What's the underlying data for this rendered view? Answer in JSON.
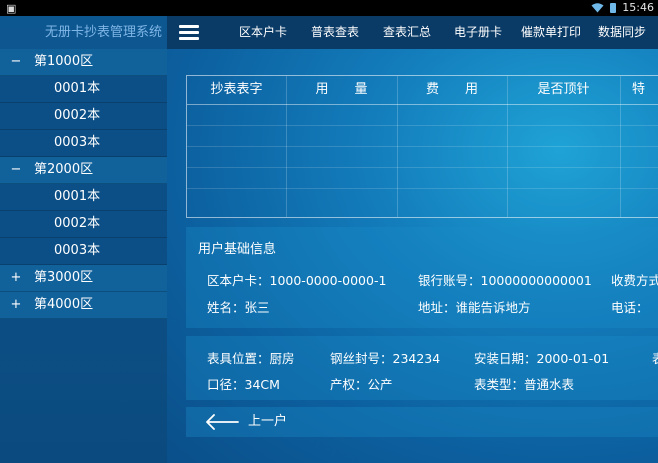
{
  "status": {
    "time": "15:46"
  },
  "sidebar": {
    "title": "无册卡抄表管理系统",
    "groups": [
      {
        "sign": "−",
        "label": "第1000区",
        "children": [
          "0001本",
          "0002本",
          "0003本"
        ]
      },
      {
        "sign": "−",
        "label": "第2000区",
        "children": [
          "0001本",
          "0002本",
          "0003本"
        ]
      },
      {
        "sign": "+",
        "label": "第3000区"
      },
      {
        "sign": "+",
        "label": "第4000区"
      }
    ]
  },
  "nav": {
    "items": [
      "区本户卡",
      "普表查表",
      "查表汇总",
      "电子册卡",
      "催款单打印",
      "数据同步"
    ]
  },
  "table": {
    "headers": [
      "抄表表字",
      "用　　量",
      "费　　用",
      "是否顶针",
      "特"
    ]
  },
  "user_info": {
    "title": "用户基础信息",
    "card_no": "区本户卡：1000-0000-0000-1",
    "bank_account": "银行账号：10000000000001",
    "charge_mode": "收费方式",
    "name": "姓名：张三",
    "address": "地址：谁能告诉地方",
    "phone": "电话："
  },
  "meter_info": {
    "location": "表具位置：厨房",
    "seal_no": "钢丝封号：234234",
    "install_date": "安装日期：2000-01-01",
    "extra": "表",
    "caliber": "口径：34CM",
    "ownership": "产权：公产",
    "meter_type": "表类型：普通水表"
  },
  "prev": {
    "label": "上一户"
  }
}
